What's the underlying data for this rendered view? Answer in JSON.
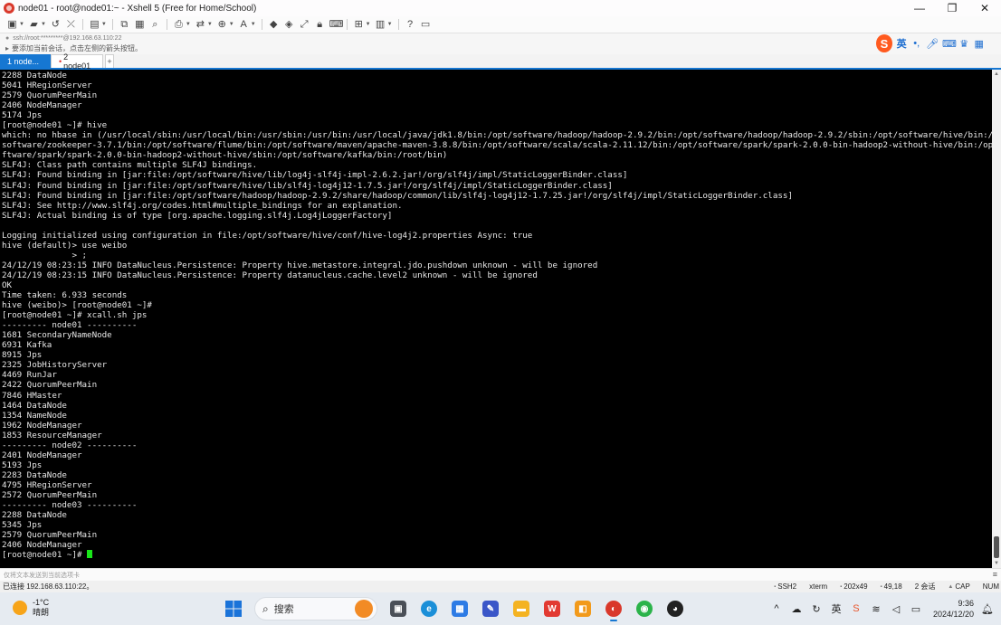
{
  "window": {
    "title": "node01 - root@node01:~ - Xshell 5 (Free for Home/School)",
    "minimize": "—",
    "maximize": "❐",
    "close": "✕"
  },
  "toolbar": {
    "icons": [
      "new-session-icon",
      "open-folder-icon",
      "reconnect-icon",
      "disconnect-icon",
      "properties-icon",
      "copy-icon",
      "paste-icon",
      "find-icon",
      "print-icon",
      "transfer-icon",
      "globe-icon",
      "font-icon",
      "xftp-icon",
      "xmanager-icon",
      "fullscreen-icon",
      "lock-icon",
      "keyboard-icon",
      "add-icon",
      "layout-icon",
      "help-icon",
      "chat-icon"
    ]
  },
  "address": {
    "text": "ssh://root:*********@192.168.63.110:22"
  },
  "hint": {
    "text": "要添加当前会话，点击左侧的箭头按钮。"
  },
  "ime": {
    "logo": "S",
    "lang": "英"
  },
  "tabs": [
    {
      "label": "1 node...",
      "active": true
    },
    {
      "label": "2 node01",
      "active": false
    }
  ],
  "tab_add": "+",
  "terminal": {
    "lines": [
      "2288 DataNode",
      "5041 HRegionServer",
      "2579 QuorumPeerMain",
      "2406 NodeManager",
      "5174 Jps",
      "[root@node01 ~]# hive",
      "which: no hbase in (/usr/local/sbin:/usr/local/bin:/usr/sbin:/usr/bin:/usr/local/java/jdk1.8/bin:/opt/software/hadoop/hadoop-2.9.2/bin:/opt/software/hadoop/hadoop-2.9.2/sbin:/opt/software/hive/bin:/opt/",
      "software/zookeeper-3.7.1/bin:/opt/software/flume/bin:/opt/software/maven/apache-maven-3.8.8/bin:/opt/software/scala/scala-2.11.12/bin:/opt/software/spark/spark-2.0.0-bin-hadoop2-without-hive/bin:/opt/so",
      "ftware/spark/spark-2.0.0-bin-hadoop2-without-hive/sbin:/opt/software/kafka/bin:/root/bin)",
      "SLF4J: Class path contains multiple SLF4J bindings.",
      "SLF4J: Found binding in [jar:file:/opt/software/hive/lib/log4j-slf4j-impl-2.6.2.jar!/org/slf4j/impl/StaticLoggerBinder.class]",
      "SLF4J: Found binding in [jar:file:/opt/software/hive/lib/slf4j-log4j12-1.7.5.jar!/org/slf4j/impl/StaticLoggerBinder.class]",
      "SLF4J: Found binding in [jar:file:/opt/software/hadoop/hadoop-2.9.2/share/hadoop/common/lib/slf4j-log4j12-1.7.25.jar!/org/slf4j/impl/StaticLoggerBinder.class]",
      "SLF4J: See http://www.slf4j.org/codes.html#multiple_bindings for an explanation.",
      "SLF4J: Actual binding is of type [org.apache.logging.slf4j.Log4jLoggerFactory]",
      "",
      "Logging initialized using configuration in file:/opt/software/hive/conf/hive-log4j2.properties Async: true",
      "hive (default)> use weibo",
      "              > ;",
      "24/12/19 08:23:15 INFO DataNucleus.Persistence: Property hive.metastore.integral.jdo.pushdown unknown - will be ignored",
      "24/12/19 08:23:15 INFO DataNucleus.Persistence: Property datanucleus.cache.level2 unknown - will be ignored",
      "OK",
      "Time taken: 6.933 seconds",
      "hive (weibo)> [root@node01 ~]#",
      "[root@node01 ~]# xcall.sh jps",
      "--------- node01 ----------",
      "1681 SecondaryNameNode",
      "6931 Kafka",
      "8915 Jps",
      "2325 JobHistoryServer",
      "4469 RunJar",
      "2422 QuorumPeerMain",
      "7846 HMaster",
      "1464 DataNode",
      "1354 NameNode",
      "1962 NodeManager",
      "1853 ResourceManager",
      "--------- node02 ----------",
      "2401 NodeManager",
      "5193 Jps",
      "2283 DataNode",
      "4795 HRegionServer",
      "2572 QuorumPeerMain",
      "--------- node03 ----------",
      "2288 DataNode",
      "5345 Jps",
      "2579 QuorumPeerMain",
      "2406 NodeManager"
    ],
    "prompt": "[root@node01 ~]# "
  },
  "sendbar": {
    "placeholder": "仅将文本发送到当前选项卡",
    "menu": "≡"
  },
  "status": {
    "connected": "已连接 192.168.63.110:22。",
    "protocol": "SSH2",
    "terminal_type": "xterm",
    "size": "202x49",
    "cursor_pos": "49,18",
    "sessions": "2 会话",
    "caps": "CAP",
    "num": "NUM"
  },
  "taskbar": {
    "weather_temp": "-1°C",
    "weather_desc": "晴朗",
    "search_label": "搜索",
    "lang": "英",
    "time": "9:36",
    "date": "2024/12/20"
  }
}
